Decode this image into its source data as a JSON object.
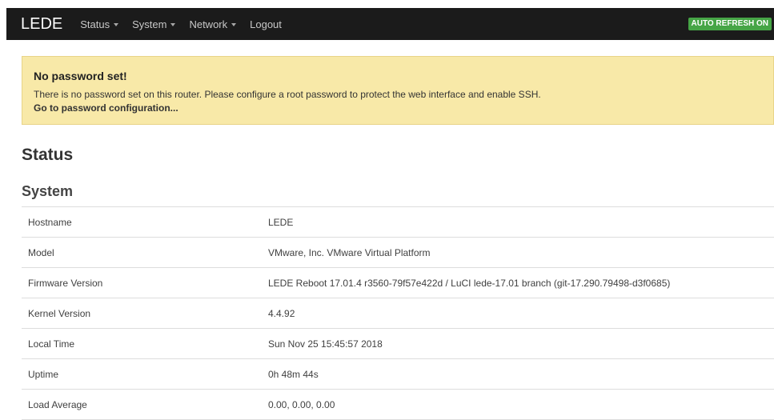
{
  "navbar": {
    "brand": "LEDE",
    "menu": [
      {
        "label": "Status",
        "dropdown": true
      },
      {
        "label": "System",
        "dropdown": true
      },
      {
        "label": "Network",
        "dropdown": true
      },
      {
        "label": "Logout",
        "dropdown": false
      }
    ],
    "auto_refresh": "AUTO REFRESH ON",
    "colors": {
      "background": "#1b1b1b",
      "refresh_badge": "#46a546"
    }
  },
  "alert": {
    "title": "No password set!",
    "message": "There is no password set on this router. Please configure a root password to protect the web interface and enable SSH.",
    "link": "Go to password configuration...",
    "color": "#f8e9a8"
  },
  "page": {
    "title": "Status",
    "section": "System"
  },
  "system_table": [
    {
      "label": "Hostname",
      "value": "LEDE"
    },
    {
      "label": "Model",
      "value": "VMware, Inc. VMware Virtual Platform"
    },
    {
      "label": "Firmware Version",
      "value": "LEDE Reboot 17.01.4 r3560-79f57e422d / LuCI lede-17.01 branch (git-17.290.79498-d3f0685)"
    },
    {
      "label": "Kernel Version",
      "value": "4.4.92"
    },
    {
      "label": "Local Time",
      "value": "Sun Nov 25 15:45:57 2018"
    },
    {
      "label": "Uptime",
      "value": "0h 48m 44s"
    },
    {
      "label": "Load Average",
      "value": "0.00, 0.00, 0.00"
    }
  ]
}
